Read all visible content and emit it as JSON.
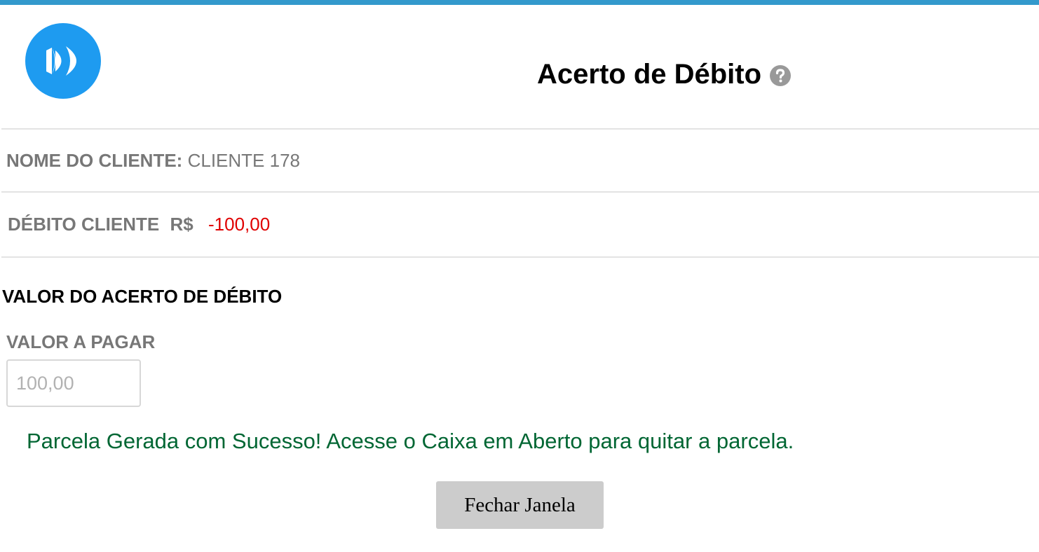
{
  "header": {
    "title": "Acerto de Débito",
    "logo_icon": "fast-forward-logo-icon",
    "help_icon": "question-circle-icon",
    "accent_color": "#3399cc",
    "logo_color": "#1e9bf0"
  },
  "client": {
    "name_label": "NOME DO CLIENTE:",
    "name_value": "CLIENTE 178"
  },
  "debit": {
    "label": "DÉBITO CLIENTE",
    "currency": "R$",
    "value": "-100,00",
    "value_color": "#e00000"
  },
  "payment": {
    "section_title": "VALOR DO ACERTO DE DÉBITO",
    "field_label": "VALOR A PAGAR",
    "input_placeholder": "100,00",
    "input_value": ""
  },
  "status": {
    "message": "Parcela Gerada com Sucesso! Acesse o Caixa em Aberto para quitar a parcela.",
    "color": "#006633"
  },
  "actions": {
    "close_label": "Fechar Janela"
  }
}
